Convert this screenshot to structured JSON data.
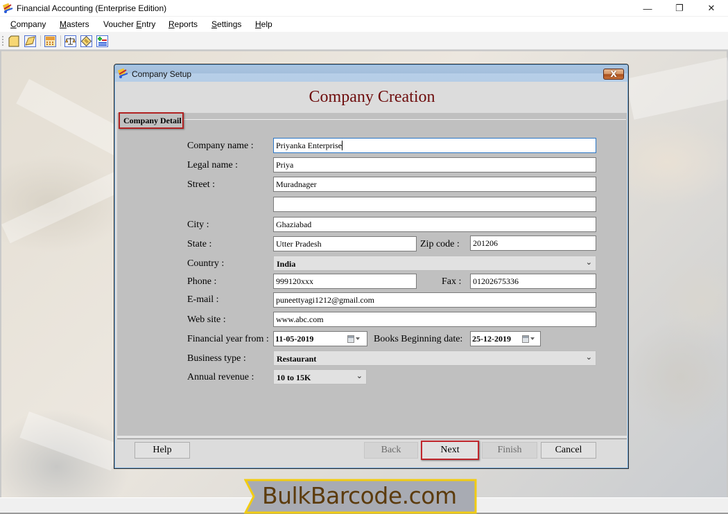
{
  "window": {
    "title": "Financial Accounting (Enterprise Edition)",
    "controls": {
      "minimize": "—",
      "maximize": "❐",
      "close": "✕"
    }
  },
  "menu": [
    {
      "label": "Company",
      "mnemonic": "C"
    },
    {
      "label": "Masters",
      "mnemonic": "M"
    },
    {
      "label": "Voucher Entry",
      "mnemonic": "E"
    },
    {
      "label": "Reports",
      "mnemonic": "R"
    },
    {
      "label": "Settings",
      "mnemonic": "S"
    },
    {
      "label": "Help",
      "mnemonic": "H"
    }
  ],
  "toolbar": {
    "buttons": [
      "new-company-icon",
      "open-company-icon",
      "calculator-icon",
      "balance-scale-icon",
      "notepad-icon",
      "add-remove-icon"
    ]
  },
  "dialog": {
    "title": "Company Setup",
    "close_label": "X",
    "heading": "Company Creation",
    "group_label": "Company Detail",
    "fields": {
      "company_name": {
        "label": "Company name :",
        "value": "Priyanka Enterprise"
      },
      "legal_name": {
        "label": "Legal name :",
        "value": "Priya"
      },
      "street": {
        "label": "Street :",
        "value": "Muradnager",
        "value2": ""
      },
      "city": {
        "label": "City :",
        "value": "Ghaziabad"
      },
      "state": {
        "label": "State :",
        "value": "Utter Pradesh"
      },
      "zip": {
        "label": "Zip code :",
        "value": "201206"
      },
      "country": {
        "label": "Country :",
        "value": "India"
      },
      "phone": {
        "label": "Phone :",
        "value": "999120xxx"
      },
      "fax": {
        "label": "Fax :",
        "value": "01202675336"
      },
      "email": {
        "label": "E-mail :",
        "value": "puneettyagi1212@gmail.com"
      },
      "website": {
        "label": "Web site :",
        "value": "www.abc.com"
      },
      "financial_year": {
        "label": "Financial year from :",
        "value": "11-05-2019"
      },
      "books_beginning": {
        "label": "Books Beginning date:",
        "value": "25-12-2019"
      },
      "business_type": {
        "label": "Business type :",
        "value": "Restaurant"
      },
      "annual_revenue": {
        "label": "Annual revenue :",
        "value": "10 to 15K"
      }
    },
    "buttons": {
      "help": "Help",
      "back": "Back",
      "next": "Next",
      "finish": "Finish",
      "cancel": "Cancel"
    }
  },
  "watermark": {
    "text": "BulkBarcode.com"
  },
  "colors": {
    "heading": "#6e0d0d",
    "highlight_border": "#c0262c",
    "watermark_text": "#5c3b0c",
    "watermark_border": "#f2cc12",
    "watermark_bg": "#a8abb3"
  }
}
